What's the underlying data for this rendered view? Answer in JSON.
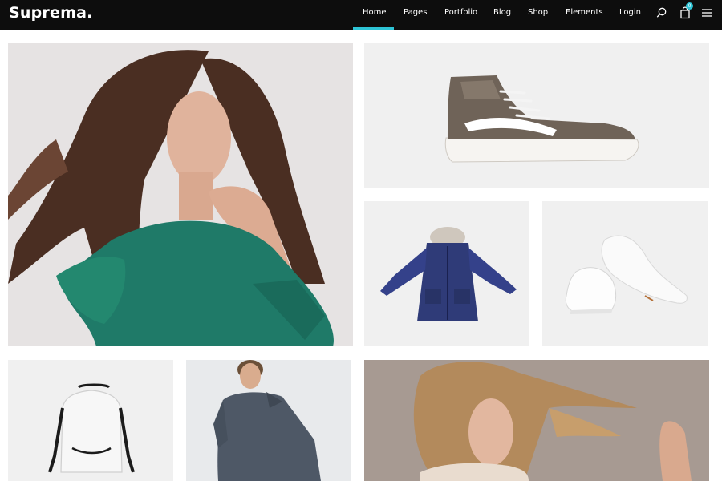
{
  "brand": {
    "name": "Suprema."
  },
  "nav": {
    "items": [
      {
        "label": "Home",
        "active": true
      },
      {
        "label": "Pages"
      },
      {
        "label": "Portfolio"
      },
      {
        "label": "Blog"
      },
      {
        "label": "Shop"
      },
      {
        "label": "Elements"
      },
      {
        "label": "Login"
      }
    ],
    "cart_count": "0"
  },
  "icons": [
    "search-icon",
    "cart-icon",
    "menu-icon"
  ],
  "colors": {
    "nav_bg": "#0d0d0d",
    "accent": "#2ec4d6",
    "tile_bg": "#f0f0f0"
  },
  "tiles": [
    {
      "name": "woman-green-sweater"
    },
    {
      "name": "hightop-sneaker"
    },
    {
      "name": "navy-parka"
    },
    {
      "name": "white-sneakers"
    },
    {
      "name": "white-backpack"
    },
    {
      "name": "man-gray-sweater"
    },
    {
      "name": "woman-blonde-hair"
    }
  ]
}
